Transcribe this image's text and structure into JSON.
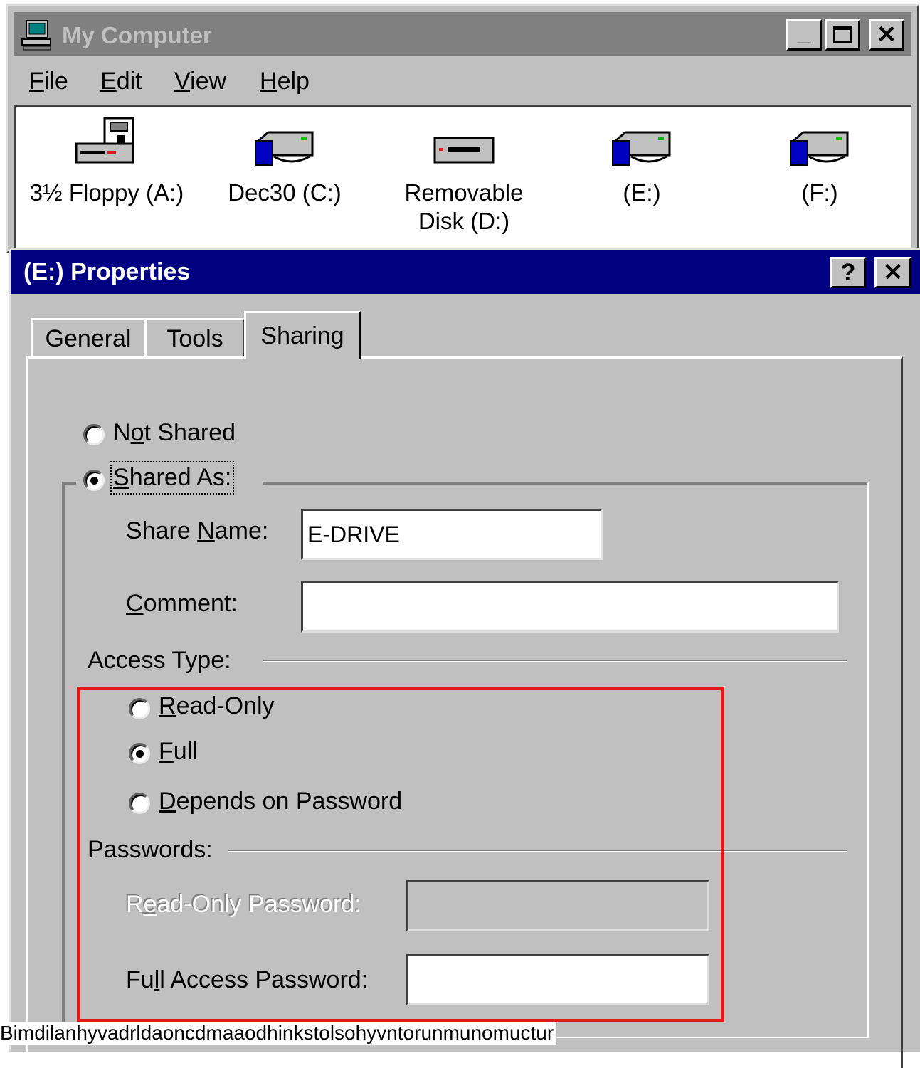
{
  "my_computer": {
    "title": "My Computer",
    "controls": {
      "minimize": "_",
      "maximize": "☐",
      "close": "✕"
    },
    "menu": [
      "File",
      "Edit",
      "View",
      "Help"
    ],
    "drives": [
      {
        "label": "3½ Floppy (A:)",
        "icon": "floppy-drive-icon"
      },
      {
        "label": "Dec30 (C:)",
        "icon": "hard-drive-icon"
      },
      {
        "label_line1": "Removable",
        "label_line2": "Disk (D:)",
        "icon": "removable-disk-icon"
      },
      {
        "label": "(E:)",
        "icon": "hard-drive-icon"
      },
      {
        "label": "(F:)",
        "icon": "hard-drive-icon"
      }
    ]
  },
  "properties": {
    "title": "(E:) Properties",
    "controls": {
      "help": "?",
      "close": "✕"
    },
    "tabs": [
      "General",
      "Tools",
      "Sharing"
    ],
    "active_tab": "Sharing",
    "not_shared_label": "Not Shared",
    "shared_as_label": "Shared As:",
    "share_name_label": "Share Name:",
    "share_name_value": "E-DRIVE",
    "comment_label": "Comment:",
    "comment_value": "",
    "access_type_label": "Access Type:",
    "access_options": [
      "Read-Only",
      "Full",
      "Depends on Password"
    ],
    "selected_access": "Full",
    "passwords_label": "Passwords:",
    "read_only_password_label": "Read-Only Password:",
    "full_access_password_label": "Full Access Password:"
  },
  "caption": "Bimdilanhyvadrldaoncdmaaodhinkstolsohyvntorunmunomuctur",
  "colors": {
    "highlight": "#e01818",
    "titlebar_active": "#000080",
    "titlebar_inactive": "#808080",
    "face": "#c0c0c0"
  }
}
